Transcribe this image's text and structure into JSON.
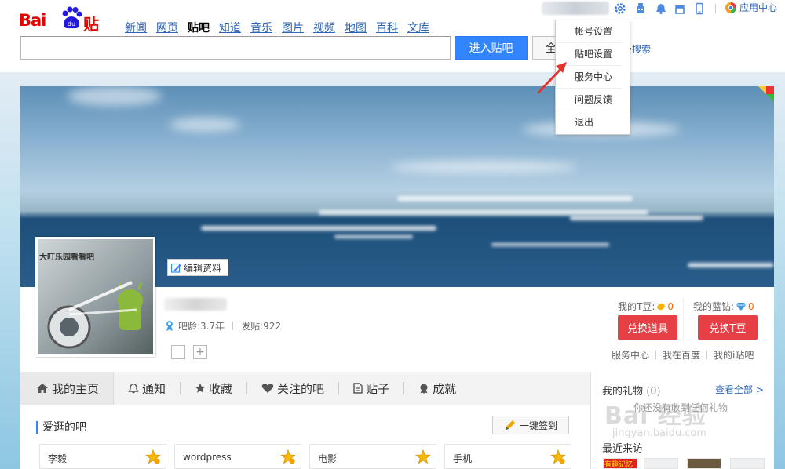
{
  "logo": {
    "text_bai": "Bai",
    "text_du": "du",
    "text_tieba": "贴吧"
  },
  "nav": [
    "新闻",
    "网页",
    "贴吧",
    "知道",
    "音乐",
    "图片",
    "视频",
    "地图",
    "百科",
    "文库"
  ],
  "nav_active": "贴吧",
  "search": {
    "placeholder": "",
    "enter_label": "进入贴吧",
    "all_label": "全",
    "advanced_label": "级搜索"
  },
  "topbar": {
    "app_center_label": "应用中心"
  },
  "dropdown": [
    "帐号设置",
    "贴吧设置",
    "服务中心",
    "问题反馈",
    "退出"
  ],
  "profile": {
    "edit_label": "编辑资料",
    "avatar_caption": "大叮乐园看看吧",
    "age_label": "吧龄:3.7年",
    "posts_label": "发贴:922",
    "tdou_label": "我的T豆:",
    "tdou_value": "0",
    "diamond_label": "我的蓝钻:",
    "diamond_value": "0",
    "exchange_item_label": "兑换道具",
    "exchange_t_label": "兑换T豆",
    "links": [
      "服务中心",
      "我在百度",
      "我的i贴吧"
    ]
  },
  "tabs": [
    "我的主页",
    "通知",
    "收藏",
    "关注的吧",
    "贴子",
    "成就"
  ],
  "main": {
    "fav_title": "爱逛的吧",
    "sign_label": "一键签到",
    "bars": [
      "李毅",
      "wordpress",
      "电影",
      "手机"
    ]
  },
  "side": {
    "gift_title": "我的礼物",
    "gift_count": "(0)",
    "view_all": "查看全部 >",
    "no_gift": "你还没有收到任何礼物",
    "recent_title": "最近来访",
    "visitor_badge": "有趣记忆"
  },
  "watermark": {
    "text": "Bai 经验",
    "url": "jingyan.baidu.com"
  },
  "colors": {
    "brand_red": "#e10602",
    "link_blue": "#2d64b3",
    "button_blue": "#3385ff",
    "button_red": "#e64046",
    "arrow_red": "#e5322d"
  }
}
